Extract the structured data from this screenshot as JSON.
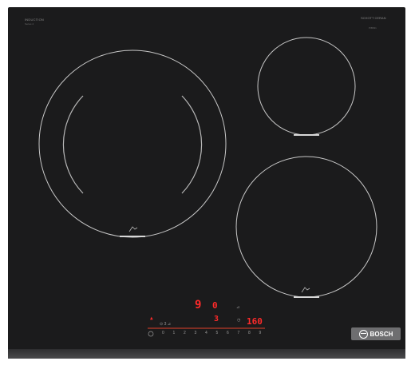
{
  "product": {
    "top_left_label": "INDUCTION",
    "top_left_sub": "Series 4",
    "top_right_label": "SCHOTT CERAN",
    "top_right_sub": "PIB631",
    "brand": "BOSCH"
  },
  "control_panel": {
    "timer_display": "9",
    "zone_display": "0",
    "power_level": "3",
    "temperature_display": "160",
    "slider_numbers": [
      "0",
      "1",
      "2",
      "3",
      "4",
      "5",
      "6",
      "7",
      "8",
      "9"
    ],
    "small_label_left": "⊙ 3 ⊿",
    "small_label_right": "⊿"
  },
  "colors": {
    "surface": "#1b1b1c",
    "ring": "#c8c8c8",
    "display_red": "#ff2a2a",
    "brand_badge": "#6e6e70"
  }
}
